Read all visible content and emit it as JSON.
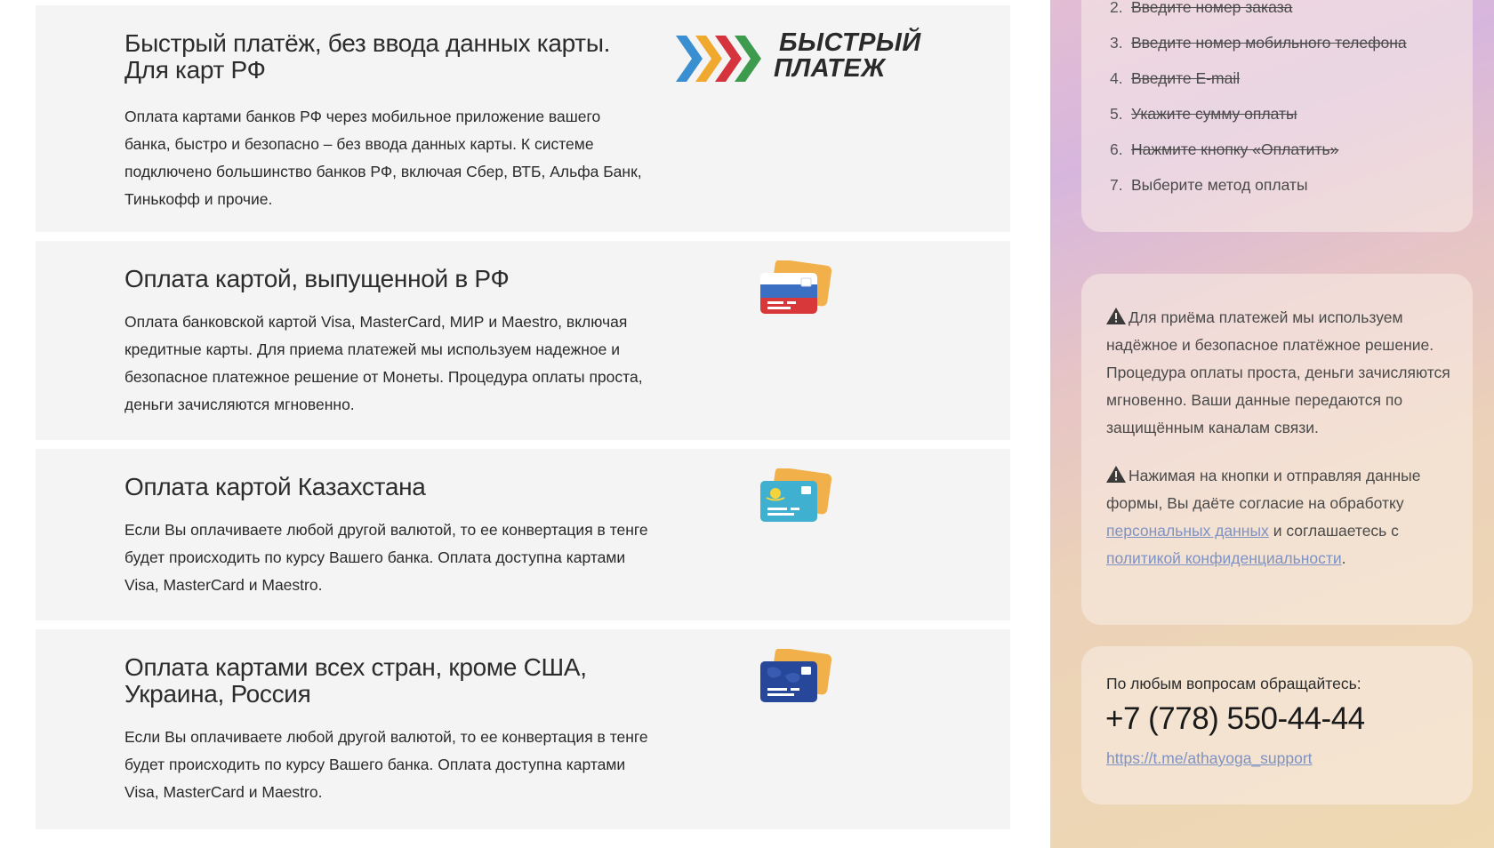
{
  "methods": [
    {
      "title": "Быстрый платёж, без ввода данных карты. Для карт РФ",
      "description": "Оплата картами банков РФ через мобильное приложение вашего банка, быстро и безопасно – без ввода данных карты. К системе подключено большинство банков РФ, включая Сбер, ВТБ, Альфа Банк, Тинькофф и прочие.",
      "logo_line1": "БЫСТРЫЙ",
      "logo_line2": "ПЛАТЕЖ",
      "icon": "fast-payment-logo"
    },
    {
      "title": "Оплата картой, выпущенной в РФ",
      "description": "Оплата банковской картой Visa, MasterCard, МИР и Maestro, включая кредитные карты. Для приема платежей мы используем надежное и безопасное платежное решение от Монеты. Процедура оплаты проста, деньги зачисляются мгновенно.",
      "icon": "russia-card-icon"
    },
    {
      "title": "Оплата картой Казахстана",
      "description": "Если Вы оплачиваете любой другой валютой, то ее конвертация в тенге будет происходить по курсу Вашего банка. Оплата доступна картами Visa, MasterCard и Maestro.",
      "icon": "kazakhstan-card-icon"
    },
    {
      "title": "Оплата картами всех стран, кроме США, Украина, Россия",
      "description": "Если Вы оплачиваете любой другой валютой, то ее конвертация в тенге будет происходить по курсу Вашего банка. Оплата доступна картами Visa, MasterCard и Maestro.",
      "icon": "world-card-icon"
    }
  ],
  "steps": [
    {
      "num": "2.",
      "text": "Введите номер заказа",
      "done": true
    },
    {
      "num": "3.",
      "text": "Введите номер мобильного телефона",
      "done": true
    },
    {
      "num": "4.",
      "text": "Введите E-mail",
      "done": true
    },
    {
      "num": "5.",
      "text": "Укажите сумму оплаты",
      "done": true
    },
    {
      "num": "6.",
      "text": "Нажмите кнопку «Оплатить»",
      "done": true
    },
    {
      "num": "7.",
      "text": "Выберите метод оплаты",
      "done": false
    }
  ],
  "info": {
    "note1": "Для приёма платежей мы используем надёжное и безопасное платёжное решение. Процедура оплаты проста, деньги зачисляются мгновенно. Ваши данные передаются по защищённым каналам связи.",
    "note2_before": "Нажимая на кнопки и отправляя данные формы, Вы даёте согласие на обработку",
    "note2_link1": "персональных данных",
    "note2_middle": "и соглашаетесь с",
    "note2_link2": "политикой конфиденциальности",
    "note2_after": "."
  },
  "contact": {
    "label": "По любым вопросам обращайтесь:",
    "phone": "+7 (778) 550-44-44",
    "link": "https://t.me/athayoga_support"
  },
  "colors": {
    "card_bg": "#f4f4f4",
    "link": "#7e92c4",
    "logo_blue": "#3a8fd0",
    "logo_orange": "#f0a92f",
    "logo_red": "#d5333d",
    "logo_green": "#3d9b4e"
  }
}
